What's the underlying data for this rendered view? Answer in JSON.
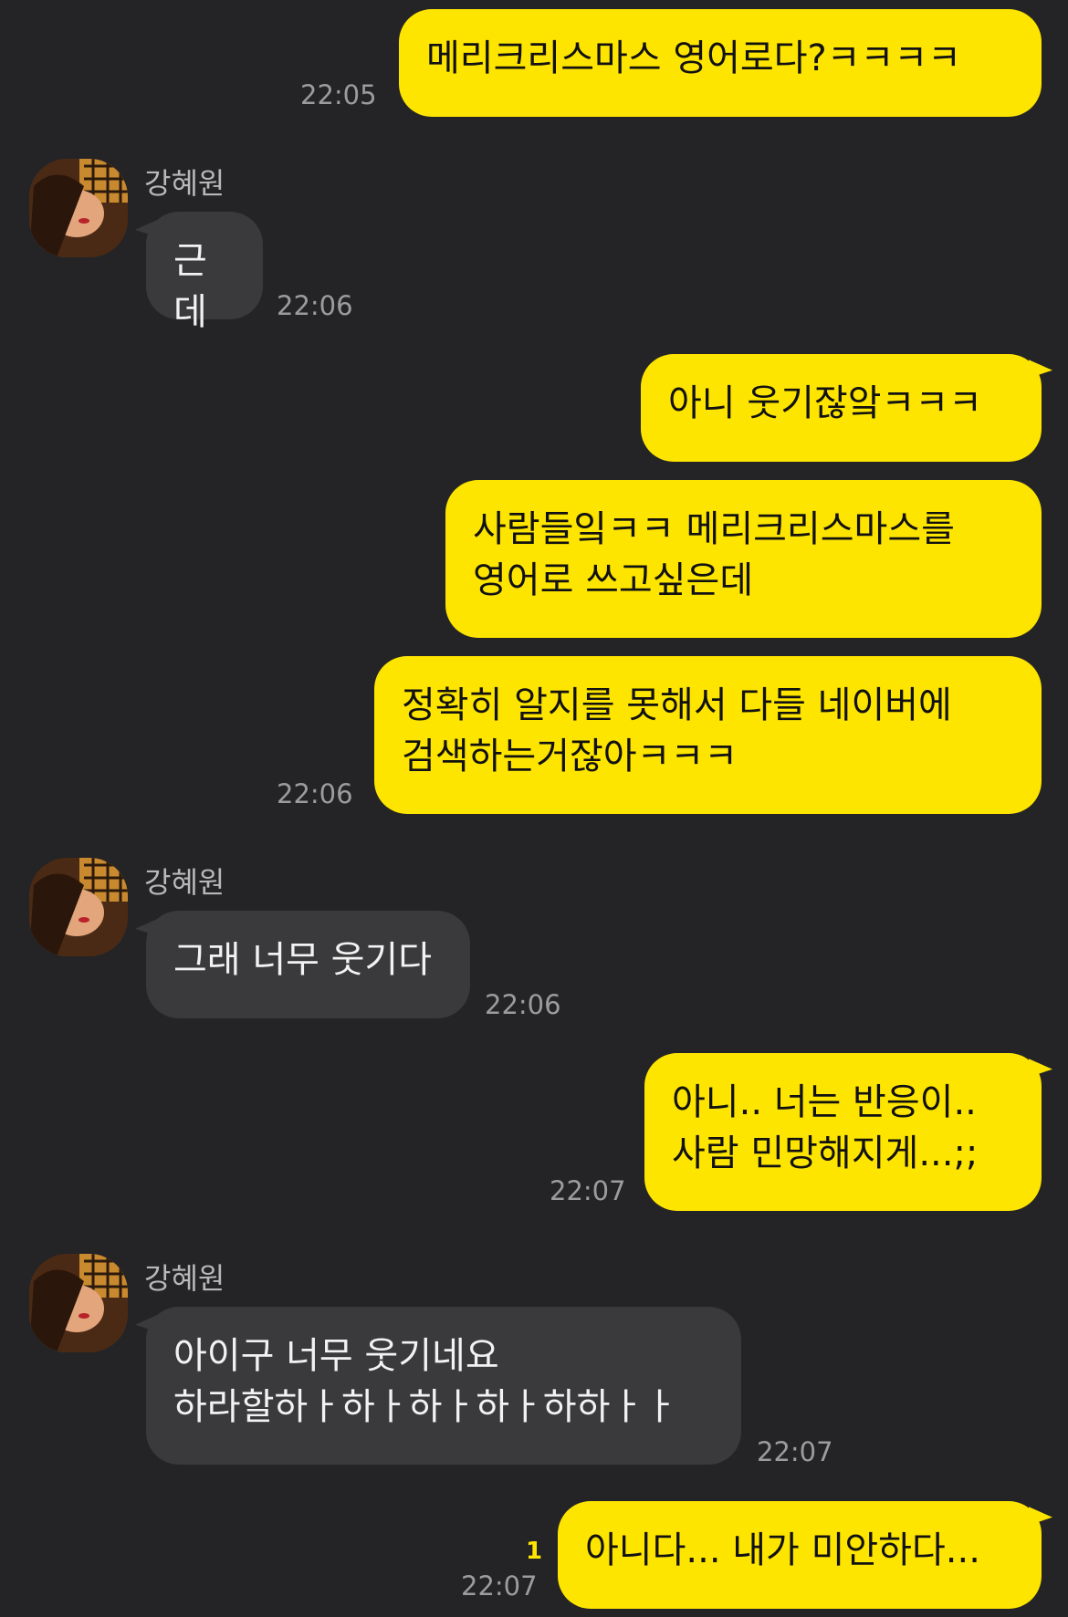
{
  "contact": {
    "name": "강혜원"
  },
  "colors": {
    "background": "#242426",
    "outgoing_bubble": "#FEE500",
    "incoming_bubble": "#3a3a3c"
  },
  "messages": [
    {
      "side": "out",
      "text": "메리크리스마스 영어로다?ㅋㅋㅋㅋ",
      "time": "22:05"
    },
    {
      "side": "in",
      "sender": "강혜원",
      "text": "근데",
      "time": "22:06"
    },
    {
      "side": "out",
      "text": "아니 웃기잖앜ㅋㅋㅋ"
    },
    {
      "side": "out",
      "text": "사람들잌ㅋㅋ 메리크리스마스를\n영어로 쓰고싶은데"
    },
    {
      "side": "out",
      "text": "정확히 알지를 못해서 다들 네이버에\n검색하는거잖아ㅋㅋㅋ",
      "time": "22:06"
    },
    {
      "side": "in",
      "sender": "강혜원",
      "text": "그래 너무 웃기다",
      "time": "22:06"
    },
    {
      "side": "out",
      "text": "아니.. 너는 반응이..\n사람 민망해지게...;;",
      "time": "22:07"
    },
    {
      "side": "in",
      "sender": "강혜원",
      "text": "아이구 너무 웃기네요\n하라할하ㅏ하ㅏ하ㅏ하ㅏ하하ㅏㅏ",
      "time": "22:07"
    },
    {
      "side": "out",
      "text": "아니다... 내가 미안하다...",
      "time": "22:07",
      "unread": "1"
    }
  ]
}
